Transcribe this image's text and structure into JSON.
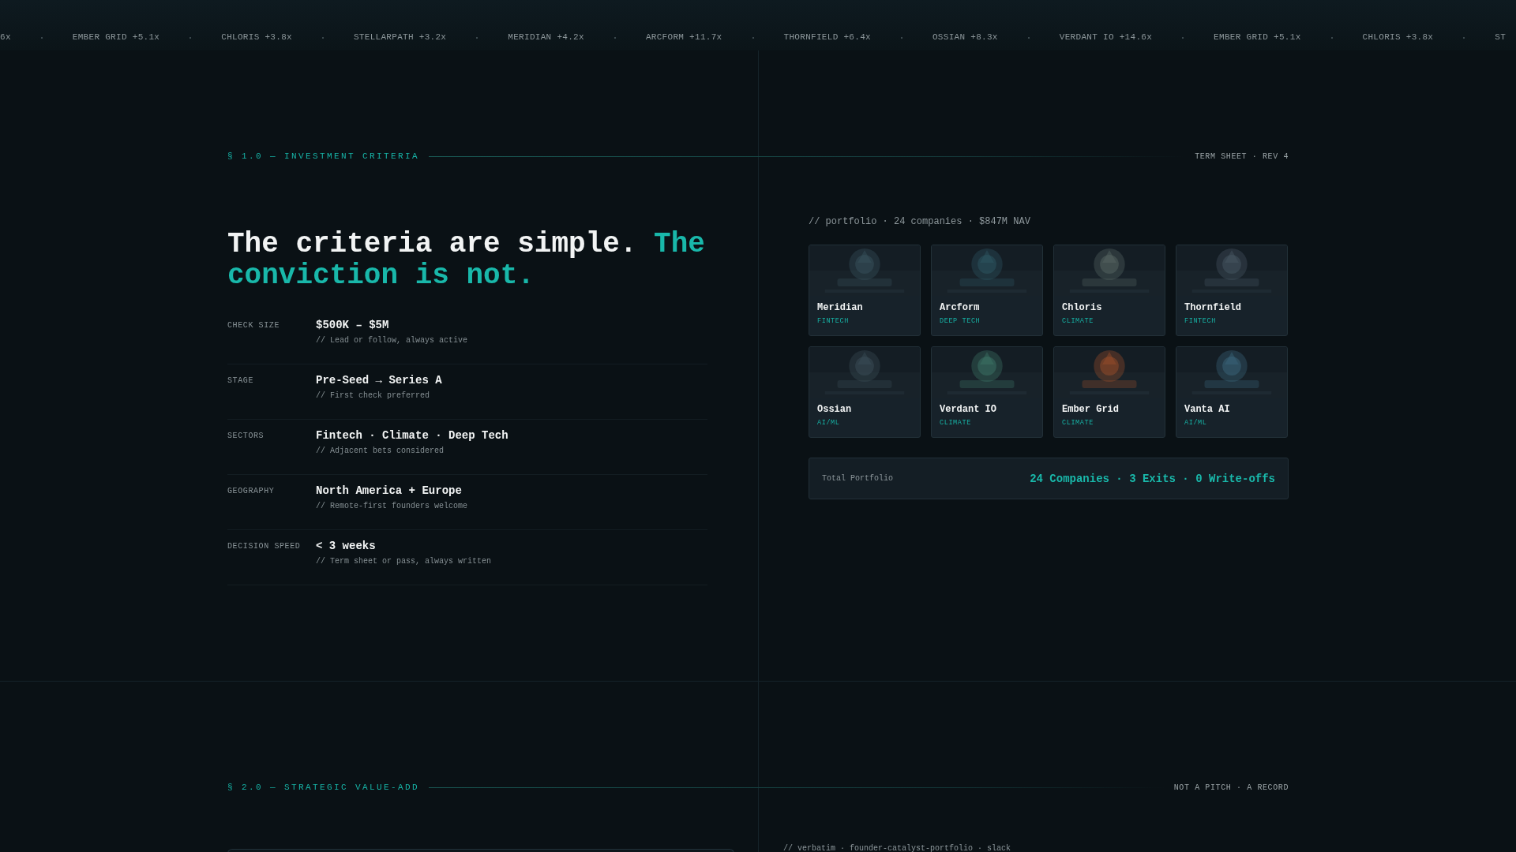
{
  "ticker": [
    "6x",
    "EMBER GRID +5.1x",
    "CHLORIS +3.8x",
    "STELLARPATH +3.2x",
    "MERIDIAN +4.2x",
    "ARCFORM +11.7x",
    "THORNFIELD +6.4x",
    "OSSIAN +8.3x",
    "VERDANT IO +14.6x",
    "EMBER GRID +5.1x",
    "CHLORIS +3.8x",
    "ST"
  ],
  "criteria_section": {
    "label": "§ 1.0 — INVESTMENT CRITERIA",
    "aside": "TERM SHEET · REV 4",
    "headline": {
      "plain": "The criteria are simple.",
      "accent": "The conviction is not."
    },
    "criteria": [
      {
        "label": "CHECK SIZE",
        "value": "$500K – $5M",
        "note": "// Lead or follow, always active"
      },
      {
        "label": "STAGE",
        "value": "Pre-Seed → Series A",
        "note": "// First check preferred"
      },
      {
        "label": "SECTORS",
        "value": "Fintech · Climate · Deep Tech",
        "note": "// Adjacent bets considered"
      },
      {
        "label": "GEOGRAPHY",
        "value": "North America + Europe",
        "note": "// Remote-first founders welcome"
      },
      {
        "label": "DECISION SPEED",
        "value": "< 3 weeks",
        "note": "// Term sheet or pass, always written"
      }
    ],
    "portfolio": {
      "caption": "// portfolio · 24 companies · $847M NAV",
      "companies": [
        {
          "name": "Meridian",
          "sector": "FINTECH"
        },
        {
          "name": "Arcform",
          "sector": "DEEP TECH"
        },
        {
          "name": "Chloris",
          "sector": "CLIMATE"
        },
        {
          "name": "Thornfield",
          "sector": "FINTECH"
        },
        {
          "name": "Ossian",
          "sector": "AI/ML"
        },
        {
          "name": "Verdant IO",
          "sector": "CLIMATE"
        },
        {
          "name": "Ember Grid",
          "sector": "CLIMATE"
        },
        {
          "name": "Vanta AI",
          "sector": "AI/ML"
        }
      ],
      "total": {
        "label": "Total Portfolio",
        "value": "24 Companies · 3 Exits · 0 Write-offs"
      }
    }
  },
  "value_section": {
    "label": "§ 2.0 — STRATEGIC VALUE-ADD",
    "aside": "NOT A PITCH · A RECORD",
    "caption": "// verbatim · founder-catalyst-portfolio · slack"
  }
}
